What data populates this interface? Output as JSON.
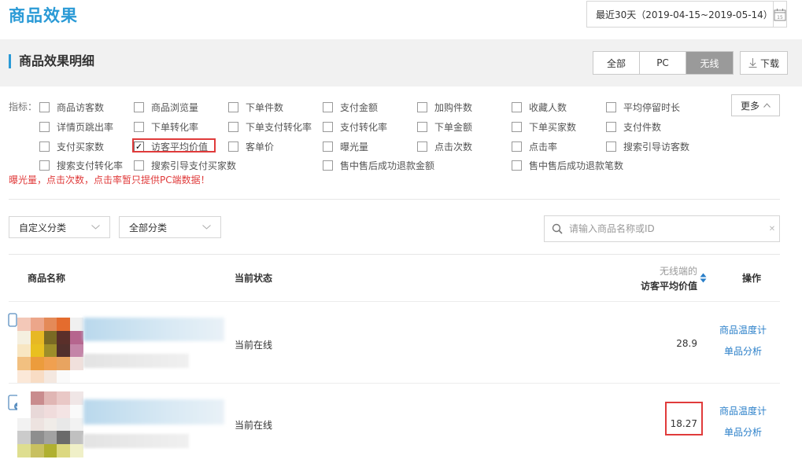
{
  "header": {
    "title": "商品效果",
    "date_range": "最近30天（2019-04-15~2019-05-14）",
    "calendar_number": "15"
  },
  "section": {
    "title": "商品效果明细",
    "segments": [
      "全部",
      "PC",
      "无线"
    ],
    "active_segment": "无线",
    "download_label": "下载"
  },
  "metrics": {
    "label": "指标：",
    "items": [
      {
        "label": "商品访客数",
        "checked": false
      },
      {
        "label": "商品浏览量",
        "checked": false
      },
      {
        "label": "下单件数",
        "checked": false
      },
      {
        "label": "支付金额",
        "checked": false
      },
      {
        "label": "加购件数",
        "checked": false
      },
      {
        "label": "收藏人数",
        "checked": false
      },
      {
        "label": "平均停留时长",
        "checked": false
      },
      {
        "label": "详情页跳出率",
        "checked": false
      },
      {
        "label": "下单转化率",
        "checked": false
      },
      {
        "label": "下单支付转化率",
        "checked": false
      },
      {
        "label": "支付转化率",
        "checked": false
      },
      {
        "label": "下单金额",
        "checked": false
      },
      {
        "label": "下单买家数",
        "checked": false
      },
      {
        "label": "支付件数",
        "checked": false
      },
      {
        "label": "支付买家数",
        "checked": false
      },
      {
        "label": "访客平均价值",
        "checked": true
      },
      {
        "label": "客单价",
        "checked": false
      },
      {
        "label": "曝光量",
        "checked": false
      },
      {
        "label": "点击次数",
        "checked": false
      },
      {
        "label": "点击率",
        "checked": false
      },
      {
        "label": "搜索引导访客数",
        "checked": false
      },
      {
        "label": "搜索支付转化率",
        "checked": false
      },
      {
        "label": "搜索引导支付买家数",
        "checked": false
      },
      {
        "label": "售中售后成功退款金额",
        "checked": false
      },
      {
        "label": "售中售后成功退款笔数",
        "checked": false
      }
    ],
    "more_label": "更多",
    "check_mark": "✓",
    "warning": "曝光量，点击次数，点击率暂只提供PC端数据！"
  },
  "filters": {
    "custom_category": "自定义分类",
    "all_category": "全部分类",
    "search_placeholder": "请输入商品名称或ID"
  },
  "table": {
    "col_name": "商品名称",
    "col_status": "当前状态",
    "col_metric_sub": "无线端的",
    "col_metric": "访客平均价值",
    "col_action": "操作",
    "rows": [
      {
        "status": "当前在线",
        "value": "28.9",
        "action1": "商品温度计",
        "action2": "单品分析"
      },
      {
        "status": "当前在线",
        "value": "18.27",
        "action1": "商品温度计",
        "action2": "单品分析"
      }
    ]
  },
  "colors": {
    "accent": "#2a9ad6",
    "link": "#2a7fc9",
    "warning": "#e03b3b",
    "active_segment_bg": "#9a9a9a"
  }
}
